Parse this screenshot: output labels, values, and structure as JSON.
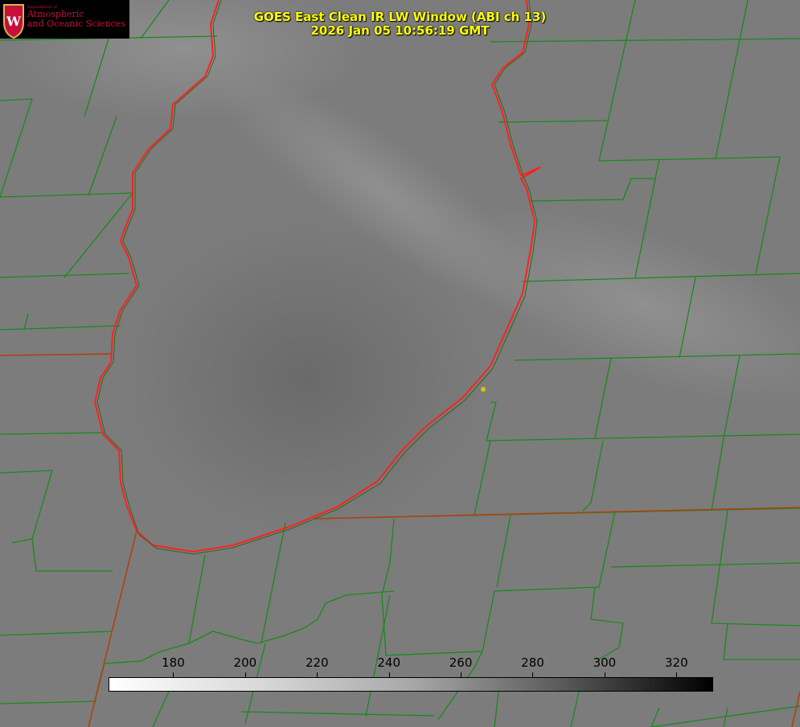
{
  "title": {
    "line1": "GOES East Clean IR LW Window (ABI ch 13)",
    "line2": "2026 Jan 05 10:56:19 GMT"
  },
  "logo": {
    "dept": "Department of",
    "line1": "Atmospheric",
    "line2": "and Oceanic Sciences",
    "emblem": "W"
  },
  "colorbar": {
    "min": 162,
    "max": 330,
    "ticks": [
      "180",
      "200",
      "220",
      "240",
      "260",
      "280",
      "300",
      "320"
    ],
    "tick_values": [
      180,
      200,
      220,
      240,
      260,
      280,
      300,
      320
    ]
  },
  "colors": {
    "county_lines": "#1a8a1a",
    "coastline": "#ff2020",
    "state_lines": "#b04010",
    "marker": "#d4c800"
  }
}
